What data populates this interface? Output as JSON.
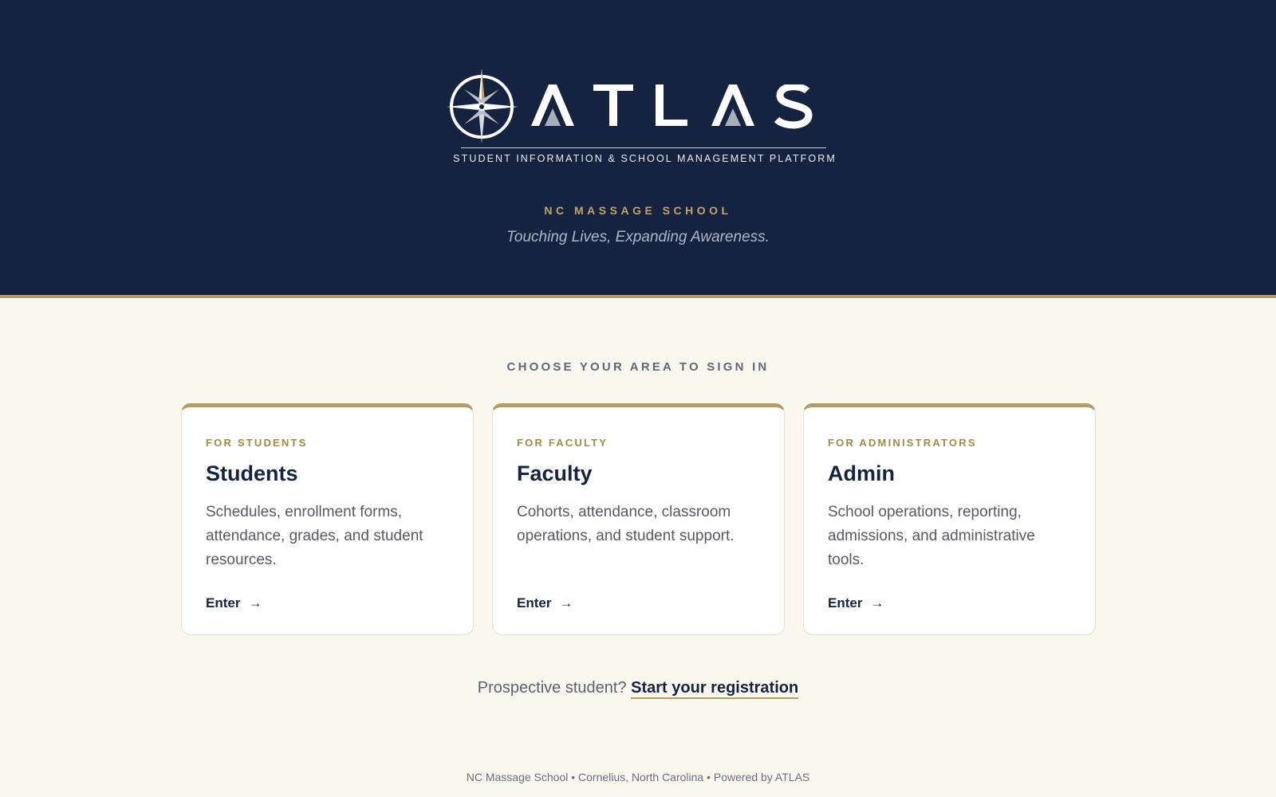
{
  "header": {
    "logo_wordmark": "ATLAS",
    "logo_tagline": "STUDENT INFORMATION & SCHOOL MANAGEMENT PLATFORM",
    "school_name": "NC MASSAGE SCHOOL",
    "motto": "Touching Lives, Expanding Awareness."
  },
  "main": {
    "heading": "CHOOSE YOUR AREA TO SIGN IN",
    "cards": [
      {
        "eyebrow": "FOR STUDENTS",
        "title": "Students",
        "description": "Schedules, enrollment forms, attendance, grades, and student resources.",
        "action": "Enter"
      },
      {
        "eyebrow": "FOR FACULTY",
        "title": "Faculty",
        "description": "Cohorts, attendance, classroom operations, and student support.",
        "action": "Enter"
      },
      {
        "eyebrow": "FOR ADMINISTRATORS",
        "title": "Admin",
        "description": "School operations, reporting, admissions, and administrative tools.",
        "action": "Enter"
      }
    ],
    "prospective_prompt": "Prospective student?",
    "registration_link": "Start your registration"
  },
  "footer": {
    "text": "NC Massage School • Cornelius, North Carolina • Powered by ATLAS"
  },
  "colors": {
    "navy": "#162340",
    "gold": "#b59a62",
    "cream": "#faf7ef"
  },
  "icons": {
    "logo": "compass-rose-icon",
    "card_action": "arrow-right-icon"
  }
}
